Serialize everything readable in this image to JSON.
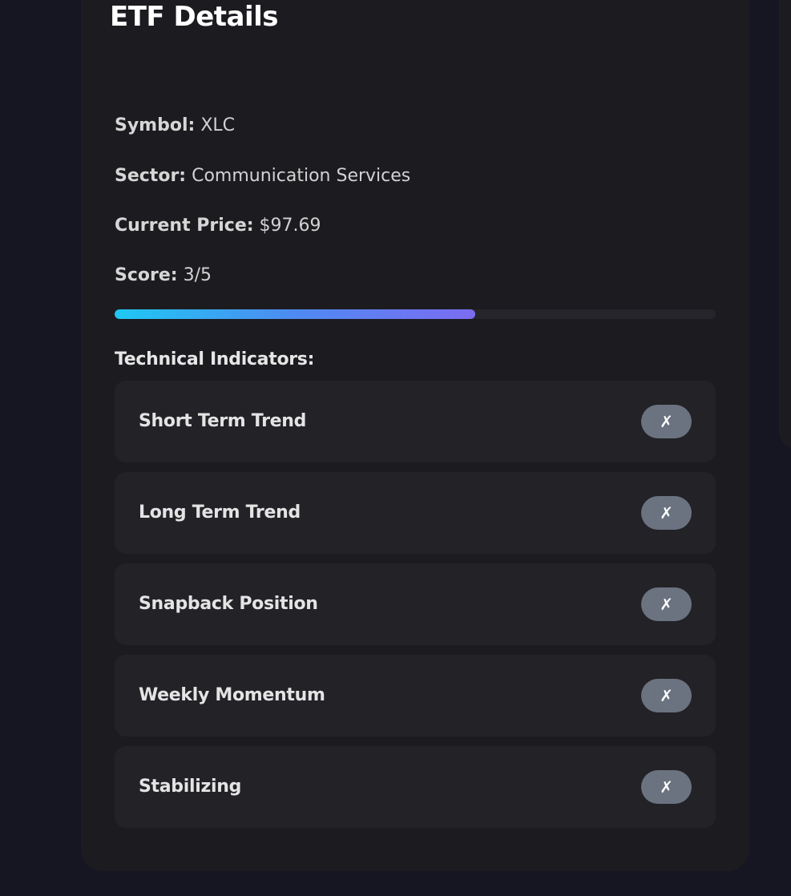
{
  "card": {
    "title": "ETF Details"
  },
  "details": {
    "symbol_label": "Symbol:",
    "symbol_value": "XLC",
    "sector_label": "Sector:",
    "sector_value": "Communication Services",
    "price_label": "Current Price:",
    "price_value": "$97.69",
    "score_label": "Score:",
    "score_value": "3/5"
  },
  "score_bar": {
    "fraction": 0.6,
    "gradient_start": "#1fc8f3",
    "gradient_end": "#7c6cf2",
    "track_color": "#25252b"
  },
  "indicators": {
    "heading": "Technical Indicators:",
    "items": [
      {
        "label": "Short Term Trend",
        "status": "✗"
      },
      {
        "label": "Long Term Trend",
        "status": "✗"
      },
      {
        "label": "Snapback Position",
        "status": "✗"
      },
      {
        "label": "Weekly Momentum",
        "status": "✗"
      },
      {
        "label": "Stabilizing",
        "status": "✗"
      }
    ]
  },
  "colors": {
    "background": "#161622",
    "card": "#1c1c20",
    "indicator_row": "#222227",
    "badge_fail": "#6b7280"
  }
}
